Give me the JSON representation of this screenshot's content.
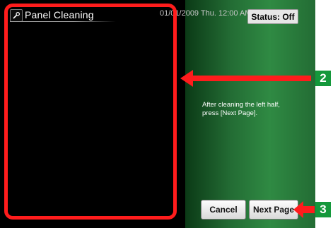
{
  "header": {
    "title": "Panel Cleaning",
    "datetime": "01/01/2009 Thu. 12:00 AM",
    "status": "Status: Off"
  },
  "instruction": "After cleaning the left half, press [Next Page].",
  "buttons": {
    "cancel": "Cancel",
    "next_page": "Next Page"
  },
  "callouts": {
    "c2": "2",
    "c3": "3"
  },
  "colors": {
    "highlight": "#ff1c1c",
    "callout_bg": "#14983b",
    "panel_green": "#2f8a43"
  }
}
